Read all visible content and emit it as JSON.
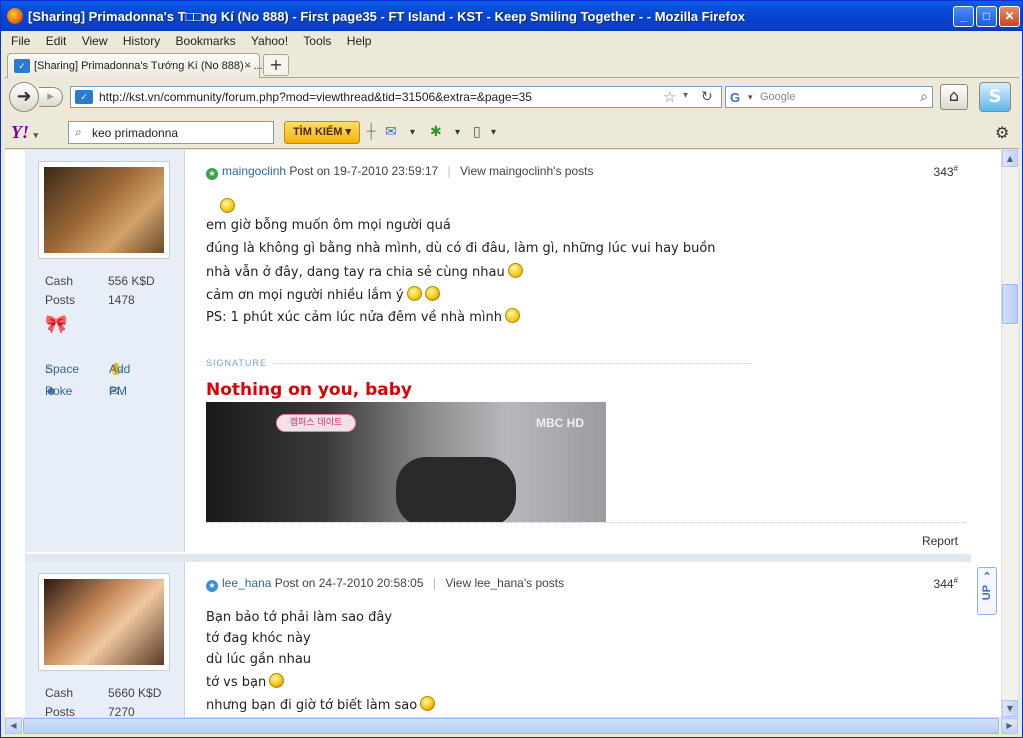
{
  "window": {
    "title": "[Sharing] Primadonna's T□□ng Kí (No 888) - First page35 - FT Island - KST - Keep Smiling Together - - Mozilla Firefox",
    "minimize": "_",
    "maximize": "□",
    "close": "✕"
  },
  "menu": [
    "File",
    "Edit",
    "View",
    "History",
    "Bookmarks",
    "Yahoo!",
    "Tools",
    "Help"
  ],
  "tab": {
    "title": "[Sharing] Primadonna's Tướng Kí (No 888) - ...",
    "close": "×",
    "new": "+"
  },
  "nav": {
    "url": "http://kst.vn/community/forum.php?mod=viewthread&tid=31506&extra=&page=35",
    "search_placeholder": "Google"
  },
  "yahoo": {
    "logo": "Y!",
    "search_value": "keo primadonna",
    "search_button": "TÌM KIẾM ▾"
  },
  "posts": [
    {
      "author": "maingoclinh",
      "post_on": "Post on 19-7-2010 23:59:17",
      "view_posts": "View maingoclinh's posts",
      "number": "343",
      "cash_label": "Cash",
      "cash_value": "556 K$D",
      "posts_label": "Posts",
      "posts_value": "1478",
      "space": "Space",
      "add": "Add",
      "poke": "Poke",
      "pm": "PM",
      "lines": [
        "em giờ bỗng muốn ôm mọi người quá",
        "đúng là không gì bằng nhà mình, dù có đi đâu, làm gì, những lúc vui hay buồn",
        "nhà vẫn ở đây, dang tay ra chia sẻ cùng nhau",
        "cảm ơn mọi người nhiều lắm ý",
        "PS: 1 phút xúc cảm lúc nửa đêm về nhà mình"
      ],
      "signature_label": "SIGNATURE",
      "signature_title": "Nothing on you, baby",
      "report": "Report"
    },
    {
      "author": "lee_hana",
      "post_on": "Post on 24-7-2010 20:58:05",
      "view_posts": "View lee_hana's posts",
      "number": "344",
      "cash_label": "Cash",
      "cash_value": "5660 K$D",
      "posts_label": "Posts",
      "posts_value": "7270",
      "lines": [
        "Bạn bảo tớ phải làm sao đây",
        "tớ đag khóc này",
        "dù lúc gần nhau",
        "tớ vs bạn",
        "nhưng bạn đi giờ tớ biết làm sao"
      ]
    }
  ],
  "up_button": "UP"
}
